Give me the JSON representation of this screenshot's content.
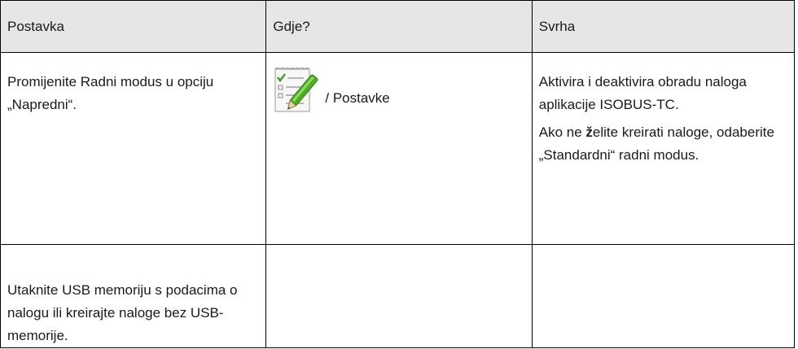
{
  "table": {
    "headers": [
      "Postavka",
      "Gdje?",
      "Svrha"
    ],
    "row1": {
      "setting": "Promijenite Radni modus u opciju „Napredni“.",
      "where_icon": "task-checklist-icon",
      "where_text": "/ Postavke",
      "purpose_p1": "Aktivira i deaktivira obradu naloga aplikacije ISOBUS-TC.",
      "purpose_p2_start": "Ako ne ",
      "purpose_p2_bold": "ž",
      "purpose_p2_rest": "elite kreirati naloge, odaberite „Standardni“ radni modus."
    },
    "row2": {
      "setting": "Utaknite USB memoriju s podacima o nalogu ili kreirajte naloge bez USB-memorije.",
      "where_text": "",
      "purpose": ""
    }
  },
  "colors": {
    "header_bg": "#e6e6e6",
    "border": "#000000",
    "icon_green": "#4caf1f"
  }
}
